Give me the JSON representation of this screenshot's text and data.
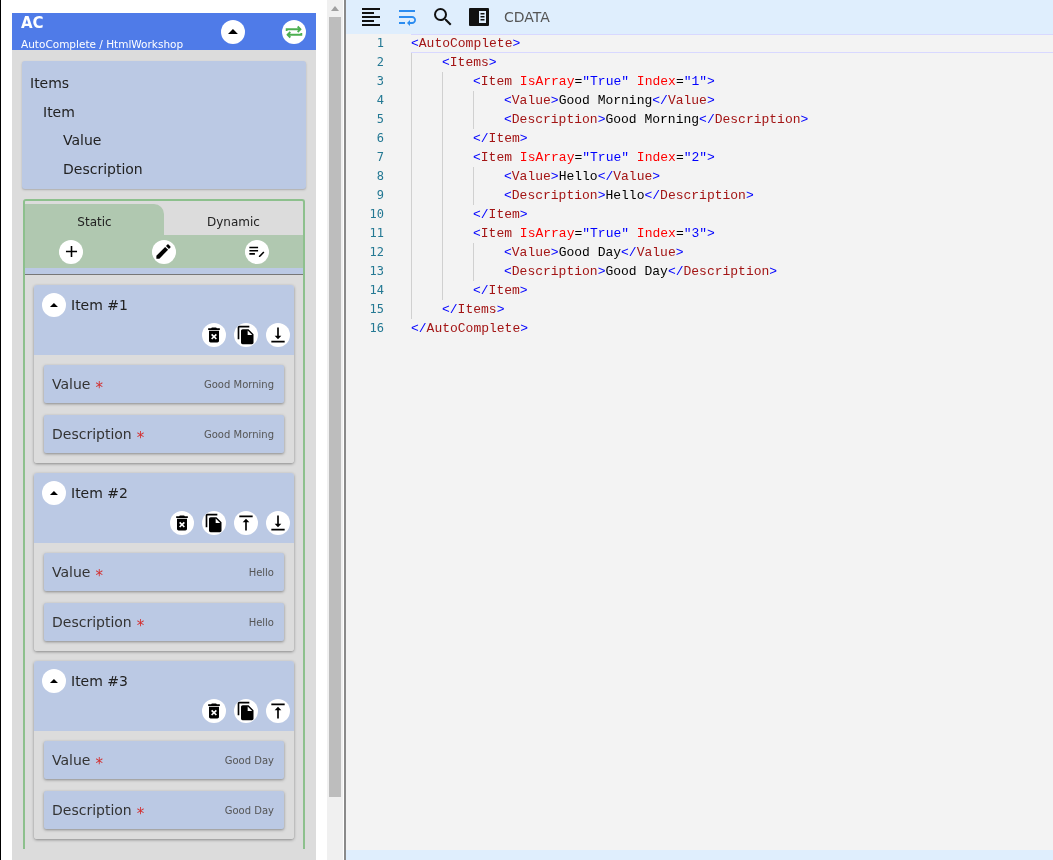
{
  "form": {
    "title": "AC",
    "subtitle": "AutoComplete / HtmlWorkshop",
    "tree": [
      {
        "label": "Items",
        "children": [
          {
            "label": "Item",
            "children": [
              {
                "label": "Value"
              },
              {
                "label": "Description"
              }
            ]
          }
        ]
      }
    ],
    "tabs": [
      {
        "label": "Static",
        "selected": true
      },
      {
        "label": "Dynamic",
        "selected": false
      }
    ],
    "tools": [
      {
        "kind": "add"
      },
      {
        "kind": "edit"
      },
      {
        "kind": "edit-list"
      }
    ],
    "items": [
      {
        "title": "Item #1",
        "expanded": true,
        "actions": [
          {
            "kind": "delete"
          },
          {
            "kind": "copy"
          },
          {
            "kind": "move-down"
          }
        ],
        "fields": [
          {
            "label": "Value",
            "required_mark": "*",
            "value": "Good Morning"
          },
          {
            "label": "Description",
            "required_mark": "*",
            "value": "Good Morning"
          }
        ]
      },
      {
        "title": "Item #2",
        "expanded": true,
        "actions": [
          {
            "kind": "delete"
          },
          {
            "kind": "copy"
          },
          {
            "kind": "move-up"
          },
          {
            "kind": "move-down"
          }
        ],
        "fields": [
          {
            "label": "Value",
            "required_mark": "*",
            "value": "Hello"
          },
          {
            "label": "Description",
            "required_mark": "*",
            "value": "Hello"
          }
        ]
      },
      {
        "title": "Item #3",
        "expanded": true,
        "actions": [
          {
            "kind": "delete"
          },
          {
            "kind": "copy"
          },
          {
            "kind": "move-up"
          }
        ],
        "fields": [
          {
            "label": "Value",
            "required_mark": "*",
            "value": "Good Day"
          },
          {
            "label": "Description",
            "required_mark": "*",
            "value": "Good Day"
          }
        ]
      }
    ]
  },
  "editor": {
    "toolbar": [
      {
        "kind": "format",
        "selected": false
      },
      {
        "kind": "wrap",
        "selected": true
      },
      {
        "kind": "search",
        "selected": false
      },
      {
        "kind": "panel",
        "selected": false
      }
    ],
    "cdata_label": "CDATA",
    "lines": [
      {
        "number": "1",
        "current": true,
        "tokens": [
          {
            "kind": "punct",
            "text": "<"
          },
          {
            "kind": "tag",
            "text": "AutoComplete"
          },
          {
            "kind": "punct",
            "text": ">"
          }
        ],
        "children": [
          {
            "number": "2",
            "current": false,
            "tokens": [
              {
                "kind": "punct",
                "text": "<"
              },
              {
                "kind": "tag",
                "text": "Items"
              },
              {
                "kind": "punct",
                "text": ">"
              }
            ],
            "children": [
              {
                "number": "3",
                "current": false,
                "tokens": [
                  {
                    "kind": "punct",
                    "text": "<"
                  },
                  {
                    "kind": "tag",
                    "text": "Item"
                  },
                  {
                    "kind": "attr",
                    "text": "IsArray"
                  },
                  {
                    "kind": "eq",
                    "text": "="
                  },
                  {
                    "kind": "value",
                    "text": "\"True\""
                  },
                  {
                    "kind": "attr",
                    "text": "Index"
                  },
                  {
                    "kind": "eq",
                    "text": "="
                  },
                  {
                    "kind": "value",
                    "text": "\"1\""
                  },
                  {
                    "kind": "punct",
                    "text": ">"
                  }
                ],
                "children": [
                  {
                    "number": "4",
                    "current": false,
                    "tokens": [
                      {
                        "kind": "punct",
                        "text": "<"
                      },
                      {
                        "kind": "tag",
                        "text": "Value"
                      },
                      {
                        "kind": "punct",
                        "text": ">"
                      },
                      {
                        "kind": "text",
                        "text": "Good Morning"
                      },
                      {
                        "kind": "punct",
                        "text": "</"
                      },
                      {
                        "kind": "tag",
                        "text": "Value"
                      },
                      {
                        "kind": "punct",
                        "text": ">"
                      }
                    ]
                  },
                  {
                    "number": "5",
                    "current": false,
                    "tokens": [
                      {
                        "kind": "punct",
                        "text": "<"
                      },
                      {
                        "kind": "tag",
                        "text": "Description"
                      },
                      {
                        "kind": "punct",
                        "text": ">"
                      },
                      {
                        "kind": "text",
                        "text": "Good Morning"
                      },
                      {
                        "kind": "punct",
                        "text": "</"
                      },
                      {
                        "kind": "tag",
                        "text": "Description"
                      },
                      {
                        "kind": "punct",
                        "text": ">"
                      }
                    ]
                  }
                ]
              },
              {
                "number": "6",
                "current": false,
                "tokens": [
                  {
                    "kind": "punct",
                    "text": "</"
                  },
                  {
                    "kind": "tag",
                    "text": "Item"
                  },
                  {
                    "kind": "punct",
                    "text": ">"
                  }
                ]
              },
              {
                "number": "7",
                "current": false,
                "tokens": [
                  {
                    "kind": "punct",
                    "text": "<"
                  },
                  {
                    "kind": "tag",
                    "text": "Item"
                  },
                  {
                    "kind": "attr",
                    "text": "IsArray"
                  },
                  {
                    "kind": "eq",
                    "text": "="
                  },
                  {
                    "kind": "value",
                    "text": "\"True\""
                  },
                  {
                    "kind": "attr",
                    "text": "Index"
                  },
                  {
                    "kind": "eq",
                    "text": "="
                  },
                  {
                    "kind": "value",
                    "text": "\"2\""
                  },
                  {
                    "kind": "punct",
                    "text": ">"
                  }
                ],
                "children": [
                  {
                    "number": "8",
                    "current": false,
                    "tokens": [
                      {
                        "kind": "punct",
                        "text": "<"
                      },
                      {
                        "kind": "tag",
                        "text": "Value"
                      },
                      {
                        "kind": "punct",
                        "text": ">"
                      },
                      {
                        "kind": "text",
                        "text": "Hello"
                      },
                      {
                        "kind": "punct",
                        "text": "</"
                      },
                      {
                        "kind": "tag",
                        "text": "Value"
                      },
                      {
                        "kind": "punct",
                        "text": ">"
                      }
                    ]
                  },
                  {
                    "number": "9",
                    "current": false,
                    "tokens": [
                      {
                        "kind": "punct",
                        "text": "<"
                      },
                      {
                        "kind": "tag",
                        "text": "Description"
                      },
                      {
                        "kind": "punct",
                        "text": ">"
                      },
                      {
                        "kind": "text",
                        "text": "Hello"
                      },
                      {
                        "kind": "punct",
                        "text": "</"
                      },
                      {
                        "kind": "tag",
                        "text": "Description"
                      },
                      {
                        "kind": "punct",
                        "text": ">"
                      }
                    ]
                  }
                ]
              },
              {
                "number": "10",
                "current": false,
                "tokens": [
                  {
                    "kind": "punct",
                    "text": "</"
                  },
                  {
                    "kind": "tag",
                    "text": "Item"
                  },
                  {
                    "kind": "punct",
                    "text": ">"
                  }
                ]
              },
              {
                "number": "11",
                "current": false,
                "tokens": [
                  {
                    "kind": "punct",
                    "text": "<"
                  },
                  {
                    "kind": "tag",
                    "text": "Item"
                  },
                  {
                    "kind": "attr",
                    "text": "IsArray"
                  },
                  {
                    "kind": "eq",
                    "text": "="
                  },
                  {
                    "kind": "value",
                    "text": "\"True\""
                  },
                  {
                    "kind": "attr",
                    "text": "Index"
                  },
                  {
                    "kind": "eq",
                    "text": "="
                  },
                  {
                    "kind": "value",
                    "text": "\"3\""
                  },
                  {
                    "kind": "punct",
                    "text": ">"
                  }
                ],
                "children": [
                  {
                    "number": "12",
                    "current": false,
                    "tokens": [
                      {
                        "kind": "punct",
                        "text": "<"
                      },
                      {
                        "kind": "tag",
                        "text": "Value"
                      },
                      {
                        "kind": "punct",
                        "text": ">"
                      },
                      {
                        "kind": "text",
                        "text": "Good Day"
                      },
                      {
                        "kind": "punct",
                        "text": "</"
                      },
                      {
                        "kind": "tag",
                        "text": "Value"
                      },
                      {
                        "kind": "punct",
                        "text": ">"
                      }
                    ]
                  },
                  {
                    "number": "13",
                    "current": false,
                    "tokens": [
                      {
                        "kind": "punct",
                        "text": "<"
                      },
                      {
                        "kind": "tag",
                        "text": "Description"
                      },
                      {
                        "kind": "punct",
                        "text": ">"
                      },
                      {
                        "kind": "text",
                        "text": "Good Day"
                      },
                      {
                        "kind": "punct",
                        "text": "</"
                      },
                      {
                        "kind": "tag",
                        "text": "Description"
                      },
                      {
                        "kind": "punct",
                        "text": ">"
                      }
                    ]
                  }
                ]
              },
              {
                "number": "14",
                "current": false,
                "tokens": [
                  {
                    "kind": "punct",
                    "text": "</"
                  },
                  {
                    "kind": "tag",
                    "text": "Item"
                  },
                  {
                    "kind": "punct",
                    "text": ">"
                  }
                ]
              }
            ]
          },
          {
            "number": "15",
            "current": false,
            "tokens": [
              {
                "kind": "punct",
                "text": "</"
              },
              {
                "kind": "tag",
                "text": "Items"
              },
              {
                "kind": "punct",
                "text": ">"
              }
            ]
          }
        ]
      },
      {
        "number": "16",
        "current": false,
        "tokens": [
          {
            "kind": "punct",
            "text": "</"
          },
          {
            "kind": "tag",
            "text": "AutoComplete"
          },
          {
            "kind": "punct",
            "text": ">"
          }
        ]
      }
    ]
  }
}
